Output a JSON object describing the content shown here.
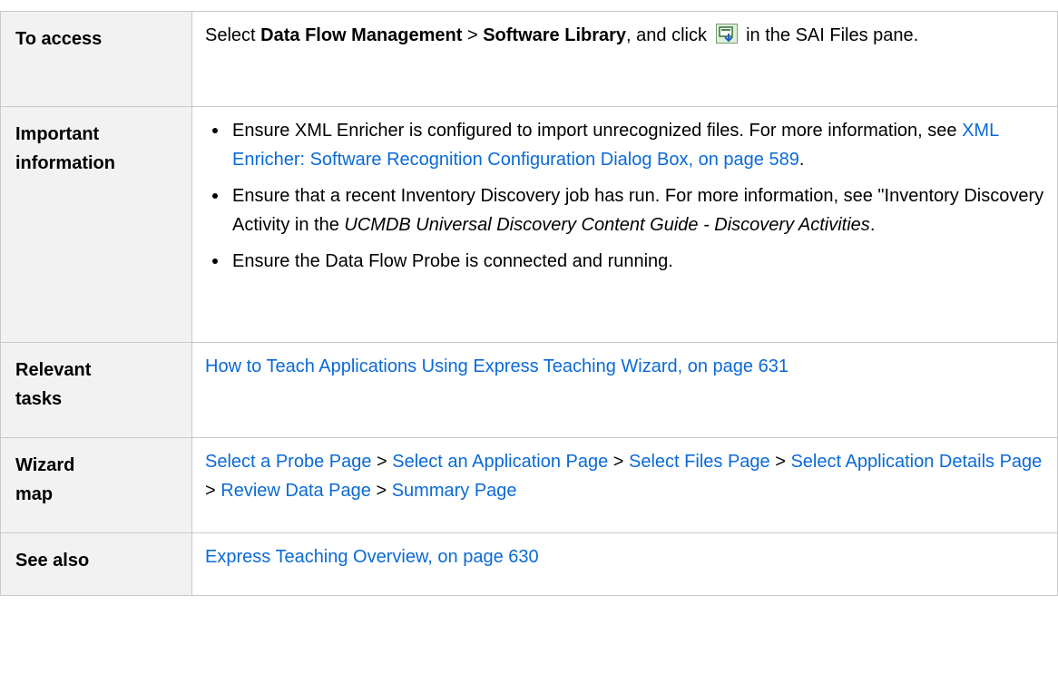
{
  "rows": {
    "access": {
      "label": "To access",
      "prefix": "Select ",
      "bold1": "Data Flow Management",
      "sep": " > ",
      "bold2": "Software Library",
      "mid": ", and click ",
      "icon": "add-sai-file-icon",
      "suffix": " in the SAI Files pane."
    },
    "important": {
      "label_line1": "Important",
      "label_line2": "information",
      "bullet1_text": "Ensure XML Enricher is configured to import unrecognized files. For more information, see ",
      "bullet1_link": "XML Enricher: Software Recognition Configuration Dialog Box, on page 589",
      "bullet1_end": ".",
      "bullet2_text": "Ensure that a recent Inventory Discovery job has run. For more information, see \"Inventory Discovery Activity in the ",
      "bullet2_italic": "UCMDB Universal Discovery Content Guide - Discovery Activities",
      "bullet2_end": ".",
      "bullet3_text": "Ensure the Data Flow Probe is connected and running."
    },
    "relevant": {
      "label_line1": "Relevant",
      "label_line2": "tasks",
      "link": "How to Teach Applications Using Express Teaching Wizard, on page 631"
    },
    "wizard": {
      "label_line1": "Wizard",
      "label_line2": "map",
      "sep": " > ",
      "steps": [
        "Select a Probe Page",
        "Select an Application Page",
        "Select Files Page",
        "Select Application Details Page",
        "Review Data Page",
        "Summary Page"
      ]
    },
    "see_also": {
      "label": "See also",
      "link": "Express Teaching Overview, on page 630"
    }
  },
  "colors": {
    "link": "#0a6ad6",
    "label_bg": "#f2f2f2",
    "border": "#c9c9c9"
  }
}
